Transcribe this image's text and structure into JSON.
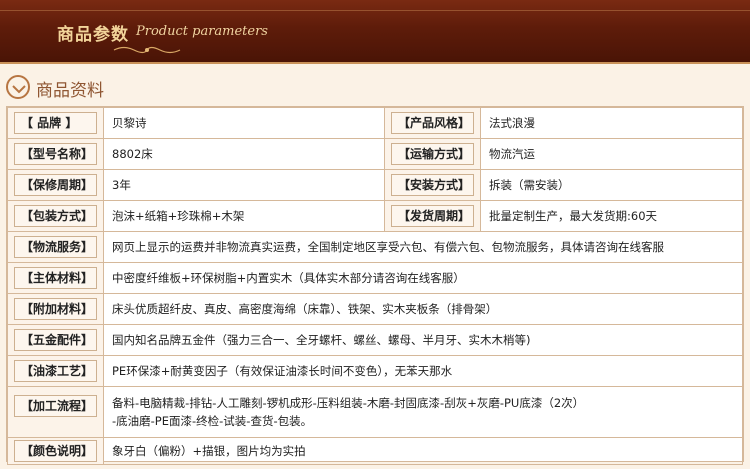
{
  "banner": {
    "title_cn": "商品参数",
    "title_en": "Product parameters"
  },
  "section": {
    "title": "商品资料",
    "icon": "info-circle-icon"
  },
  "params": {
    "brand_label": "【 品牌 】",
    "brand_value": "贝黎诗",
    "style_label": "【产品风格】",
    "style_value": "法式浪漫",
    "model_label": "【型号名称】",
    "model_value": "8802床",
    "transport_label": "【运输方式】",
    "transport_value": "物流汽运",
    "warranty_label": "【保修周期】",
    "warranty_value": "3年",
    "install_label": "【安装方式】",
    "install_value": "拆装（需安装）",
    "package_label": "【包装方式】",
    "package_value": "泡沫+纸箱+珍珠棉+木架",
    "delivery_label": "【发货周期】",
    "delivery_value": "批量定制生产，最大发货期:60天",
    "logistics_label": "【物流服务】",
    "logistics_value": "网页上显示的运费并非物流真实运费，全国制定地区享受六包、有偿六包、包物流服务，具体请咨询在线客服",
    "material_label": "【主体材料】",
    "material_value": "中密度纤维板+环保树脂+内置实木（具体实木部分请咨询在线客服）",
    "extra_label": "【附加材料】",
    "extra_value": "床头优质超纤皮、真皮、高密度海绵（床靠）、铁架、实木夹板条（排骨架）",
    "hardware_label": "【五金配件】",
    "hardware_value": "国内知名品牌五金件（强力三合一、全牙螺杆、螺丝、螺母、半月牙、实木木梢等)",
    "paint_label": "【油漆工艺】",
    "paint_value": "PE环保漆+耐黄变因子（有效保证油漆长时间不变色），无苯天那水",
    "process_label": "【加工流程】",
    "process_value_line1": "备料-电脑精裁-排钻-人工雕刻-锣机成形-压料组装-木磨-封固底漆-刮灰+灰磨-PU底漆（2次）",
    "process_value_line2": "-底油磨-PE面漆-终检-试装-查货-包装。",
    "color_label": "【颜色说明】",
    "color_value": "象牙白（偏粉）+描银，图片均为实拍"
  }
}
